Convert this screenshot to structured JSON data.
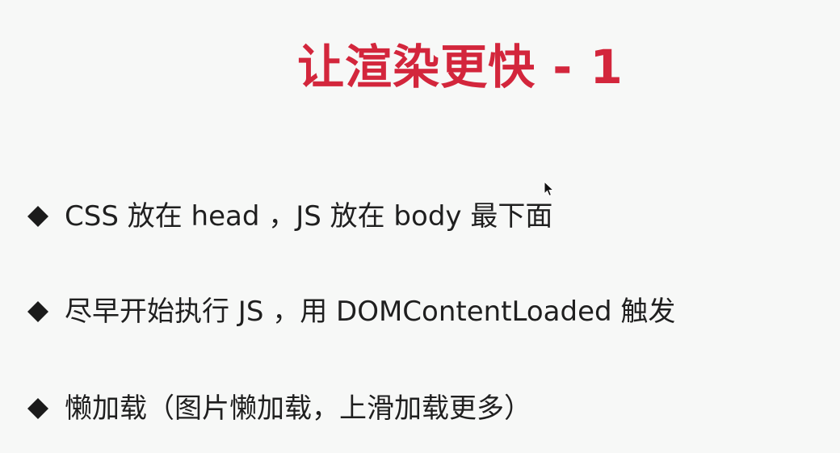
{
  "slide": {
    "title": "让渲染更快 - 1",
    "bullets": [
      {
        "text": "CSS 放在 head ，JS 放在 body 最下面"
      },
      {
        "text": "尽早开始执行 JS ，用 DOMContentLoaded 触发"
      },
      {
        "text": "懒加载（图片懒加载，上滑加载更多）"
      }
    ],
    "bullet_icon": "diamond-bullet-icon",
    "colors": {
      "title": "#d3263c",
      "text": "#1f1f1f",
      "background": "#f7f8f7"
    }
  }
}
